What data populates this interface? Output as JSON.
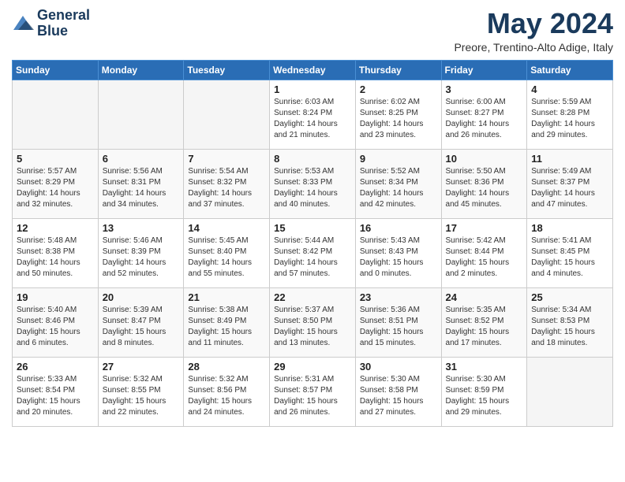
{
  "header": {
    "logo_line1": "General",
    "logo_line2": "Blue",
    "month": "May 2024",
    "location": "Preore, Trentino-Alto Adige, Italy"
  },
  "days_of_week": [
    "Sunday",
    "Monday",
    "Tuesday",
    "Wednesday",
    "Thursday",
    "Friday",
    "Saturday"
  ],
  "weeks": [
    [
      {
        "day": "",
        "info": ""
      },
      {
        "day": "",
        "info": ""
      },
      {
        "day": "",
        "info": ""
      },
      {
        "day": "1",
        "info": "Sunrise: 6:03 AM\nSunset: 8:24 PM\nDaylight: 14 hours\nand 21 minutes."
      },
      {
        "day": "2",
        "info": "Sunrise: 6:02 AM\nSunset: 8:25 PM\nDaylight: 14 hours\nand 23 minutes."
      },
      {
        "day": "3",
        "info": "Sunrise: 6:00 AM\nSunset: 8:27 PM\nDaylight: 14 hours\nand 26 minutes."
      },
      {
        "day": "4",
        "info": "Sunrise: 5:59 AM\nSunset: 8:28 PM\nDaylight: 14 hours\nand 29 minutes."
      }
    ],
    [
      {
        "day": "5",
        "info": "Sunrise: 5:57 AM\nSunset: 8:29 PM\nDaylight: 14 hours\nand 32 minutes."
      },
      {
        "day": "6",
        "info": "Sunrise: 5:56 AM\nSunset: 8:31 PM\nDaylight: 14 hours\nand 34 minutes."
      },
      {
        "day": "7",
        "info": "Sunrise: 5:54 AM\nSunset: 8:32 PM\nDaylight: 14 hours\nand 37 minutes."
      },
      {
        "day": "8",
        "info": "Sunrise: 5:53 AM\nSunset: 8:33 PM\nDaylight: 14 hours\nand 40 minutes."
      },
      {
        "day": "9",
        "info": "Sunrise: 5:52 AM\nSunset: 8:34 PM\nDaylight: 14 hours\nand 42 minutes."
      },
      {
        "day": "10",
        "info": "Sunrise: 5:50 AM\nSunset: 8:36 PM\nDaylight: 14 hours\nand 45 minutes."
      },
      {
        "day": "11",
        "info": "Sunrise: 5:49 AM\nSunset: 8:37 PM\nDaylight: 14 hours\nand 47 minutes."
      }
    ],
    [
      {
        "day": "12",
        "info": "Sunrise: 5:48 AM\nSunset: 8:38 PM\nDaylight: 14 hours\nand 50 minutes."
      },
      {
        "day": "13",
        "info": "Sunrise: 5:46 AM\nSunset: 8:39 PM\nDaylight: 14 hours\nand 52 minutes."
      },
      {
        "day": "14",
        "info": "Sunrise: 5:45 AM\nSunset: 8:40 PM\nDaylight: 14 hours\nand 55 minutes."
      },
      {
        "day": "15",
        "info": "Sunrise: 5:44 AM\nSunset: 8:42 PM\nDaylight: 14 hours\nand 57 minutes."
      },
      {
        "day": "16",
        "info": "Sunrise: 5:43 AM\nSunset: 8:43 PM\nDaylight: 15 hours\nand 0 minutes."
      },
      {
        "day": "17",
        "info": "Sunrise: 5:42 AM\nSunset: 8:44 PM\nDaylight: 15 hours\nand 2 minutes."
      },
      {
        "day": "18",
        "info": "Sunrise: 5:41 AM\nSunset: 8:45 PM\nDaylight: 15 hours\nand 4 minutes."
      }
    ],
    [
      {
        "day": "19",
        "info": "Sunrise: 5:40 AM\nSunset: 8:46 PM\nDaylight: 15 hours\nand 6 minutes."
      },
      {
        "day": "20",
        "info": "Sunrise: 5:39 AM\nSunset: 8:47 PM\nDaylight: 15 hours\nand 8 minutes."
      },
      {
        "day": "21",
        "info": "Sunrise: 5:38 AM\nSunset: 8:49 PM\nDaylight: 15 hours\nand 11 minutes."
      },
      {
        "day": "22",
        "info": "Sunrise: 5:37 AM\nSunset: 8:50 PM\nDaylight: 15 hours\nand 13 minutes."
      },
      {
        "day": "23",
        "info": "Sunrise: 5:36 AM\nSunset: 8:51 PM\nDaylight: 15 hours\nand 15 minutes."
      },
      {
        "day": "24",
        "info": "Sunrise: 5:35 AM\nSunset: 8:52 PM\nDaylight: 15 hours\nand 17 minutes."
      },
      {
        "day": "25",
        "info": "Sunrise: 5:34 AM\nSunset: 8:53 PM\nDaylight: 15 hours\nand 18 minutes."
      }
    ],
    [
      {
        "day": "26",
        "info": "Sunrise: 5:33 AM\nSunset: 8:54 PM\nDaylight: 15 hours\nand 20 minutes."
      },
      {
        "day": "27",
        "info": "Sunrise: 5:32 AM\nSunset: 8:55 PM\nDaylight: 15 hours\nand 22 minutes."
      },
      {
        "day": "28",
        "info": "Sunrise: 5:32 AM\nSunset: 8:56 PM\nDaylight: 15 hours\nand 24 minutes."
      },
      {
        "day": "29",
        "info": "Sunrise: 5:31 AM\nSunset: 8:57 PM\nDaylight: 15 hours\nand 26 minutes."
      },
      {
        "day": "30",
        "info": "Sunrise: 5:30 AM\nSunset: 8:58 PM\nDaylight: 15 hours\nand 27 minutes."
      },
      {
        "day": "31",
        "info": "Sunrise: 5:30 AM\nSunset: 8:59 PM\nDaylight: 15 hours\nand 29 minutes."
      },
      {
        "day": "",
        "info": ""
      }
    ]
  ]
}
